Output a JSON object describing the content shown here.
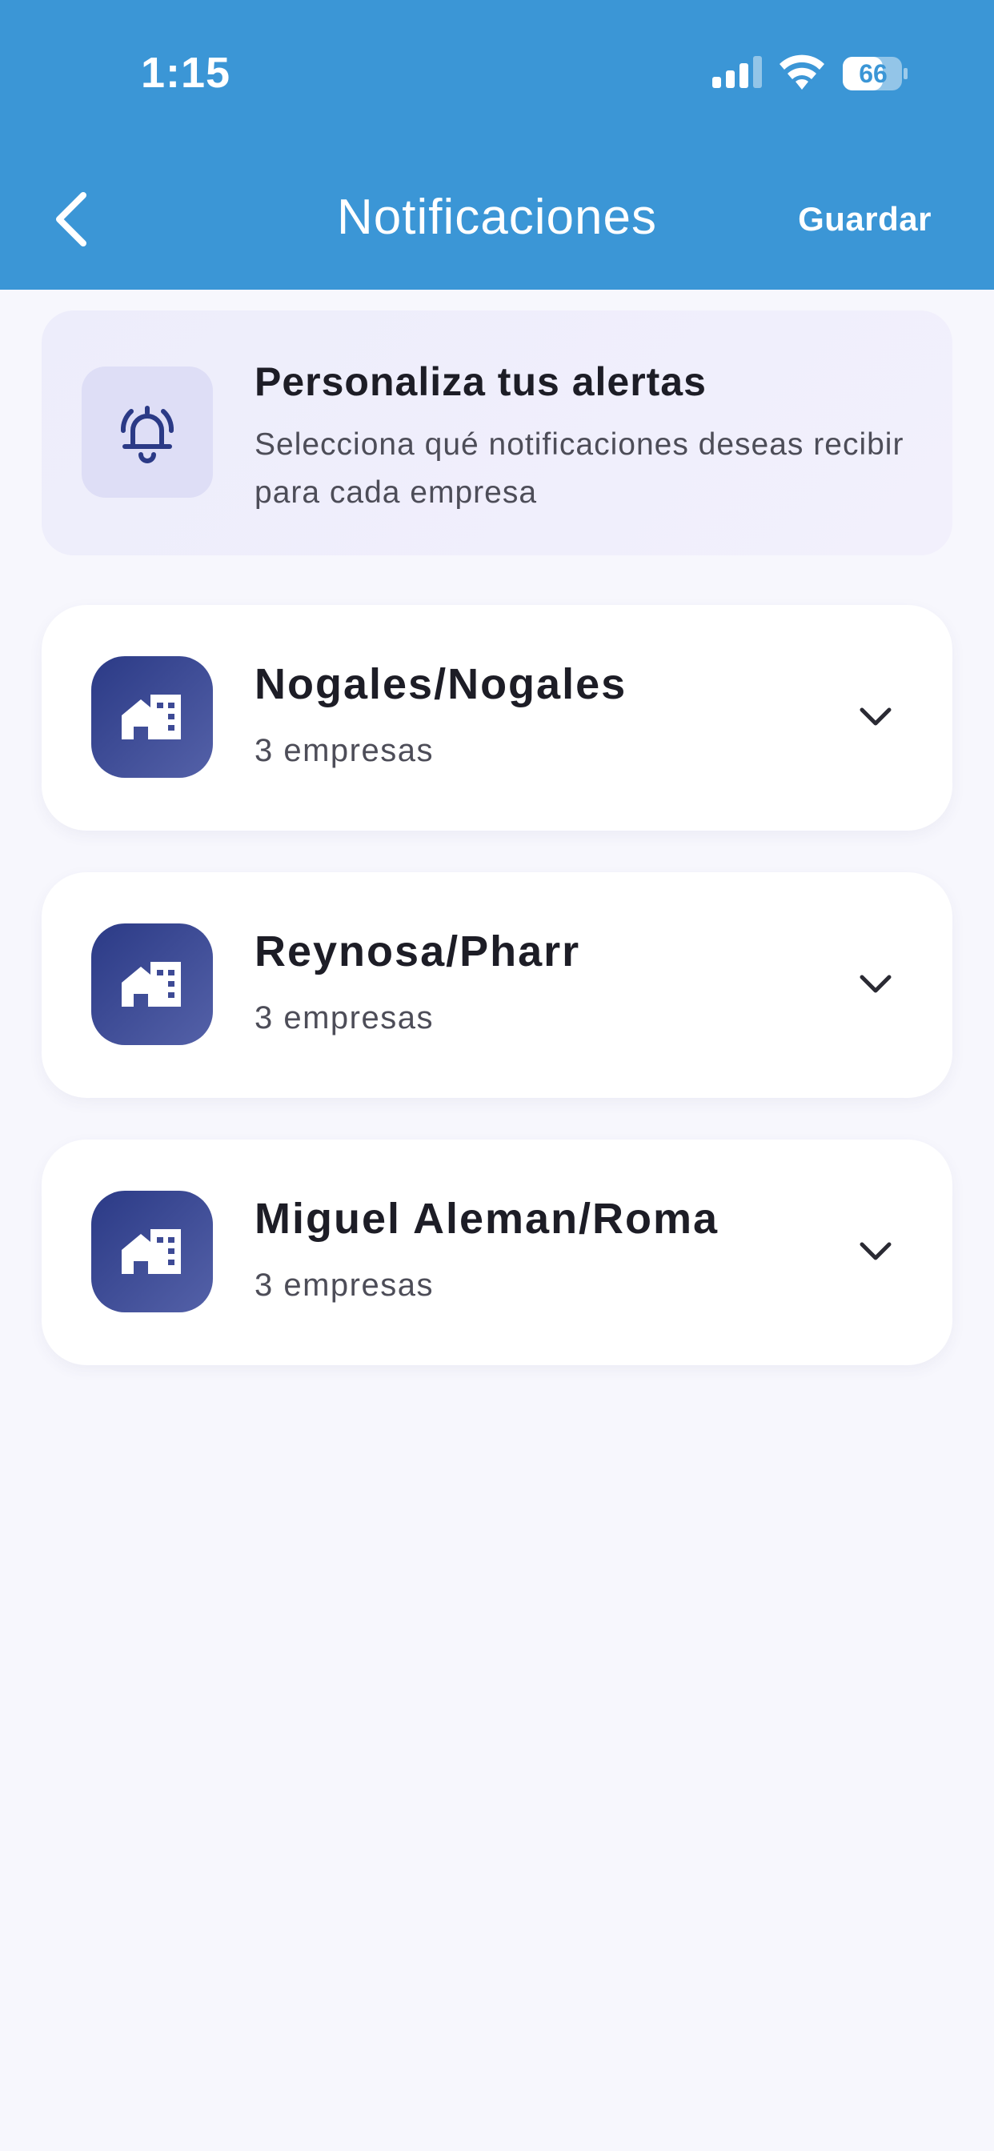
{
  "status_bar": {
    "time": "1:15",
    "battery_level": "66",
    "icons": [
      "signal-icon",
      "wifi-icon",
      "battery-icon"
    ]
  },
  "nav": {
    "back_icon": "chevron-left-icon",
    "title": "Notificaciones",
    "save_label": "Guardar"
  },
  "banner": {
    "icon": "bell-ringing-icon",
    "title": "Personaliza tus alertas",
    "description": "Selecciona qué notificaciones deseas recibir para cada empresa"
  },
  "groups": [
    {
      "icon": "building-home-icon",
      "name": "Nogales/Nogales",
      "count": "3 empresas"
    },
    {
      "icon": "building-home-icon",
      "name": "Reynosa/Pharr",
      "count": "3 empresas"
    },
    {
      "icon": "building-home-icon",
      "name": "Miguel Aleman/Roma",
      "count": "3 empresas"
    }
  ],
  "colors": {
    "header": "#3b96d6",
    "background": "#f7f7fd",
    "accent": "#2b3a86",
    "banner": "#ededfb"
  }
}
